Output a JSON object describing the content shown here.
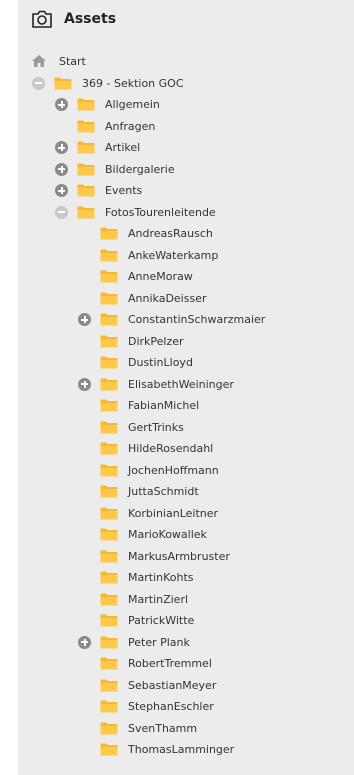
{
  "header": {
    "title": "Assets",
    "icon": "camera-icon"
  },
  "colors": {
    "panel_bg": "#ececec",
    "folder": "#f7b731",
    "toggle": "#8a8a8a"
  },
  "tree": {
    "items": [
      {
        "label": "Start",
        "level": 0,
        "icon": "home-icon",
        "toggle": "none"
      },
      {
        "label": "369 - Sektion GOC",
        "level": 1,
        "icon": "folder-icon",
        "toggle": "minus"
      },
      {
        "label": "Allgemein",
        "level": 2,
        "icon": "folder-icon",
        "toggle": "plus"
      },
      {
        "label": "Anfragen",
        "level": 2,
        "icon": "folder-icon",
        "toggle": "none"
      },
      {
        "label": "Artikel",
        "level": 2,
        "icon": "folder-icon",
        "toggle": "plus"
      },
      {
        "label": "Bildergalerie",
        "level": 2,
        "icon": "folder-icon",
        "toggle": "plus"
      },
      {
        "label": "Events",
        "level": 2,
        "icon": "folder-icon",
        "toggle": "plus"
      },
      {
        "label": "FotosTourenleitende",
        "level": 2,
        "icon": "folder-icon",
        "toggle": "minus"
      },
      {
        "label": "AndreasRausch",
        "level": 3,
        "icon": "folder-icon",
        "toggle": "none"
      },
      {
        "label": "AnkeWaterkamp",
        "level": 3,
        "icon": "folder-icon",
        "toggle": "none"
      },
      {
        "label": "AnneMoraw",
        "level": 3,
        "icon": "folder-icon",
        "toggle": "none"
      },
      {
        "label": "AnnikaDeisser",
        "level": 3,
        "icon": "folder-icon",
        "toggle": "none"
      },
      {
        "label": "ConstantinSchwarzmaier",
        "level": 3,
        "icon": "folder-icon",
        "toggle": "plus"
      },
      {
        "label": "DirkPelzer",
        "level": 3,
        "icon": "folder-icon",
        "toggle": "none"
      },
      {
        "label": "DustinLloyd",
        "level": 3,
        "icon": "folder-icon",
        "toggle": "none"
      },
      {
        "label": "ElisabethWeininger",
        "level": 3,
        "icon": "folder-icon",
        "toggle": "plus"
      },
      {
        "label": "FabianMichel",
        "level": 3,
        "icon": "folder-icon",
        "toggle": "none"
      },
      {
        "label": "GertTrinks",
        "level": 3,
        "icon": "folder-icon",
        "toggle": "none"
      },
      {
        "label": "HildeRosendahl",
        "level": 3,
        "icon": "folder-icon",
        "toggle": "none"
      },
      {
        "label": "JochenHoffmann",
        "level": 3,
        "icon": "folder-icon",
        "toggle": "none"
      },
      {
        "label": "JuttaSchmidt",
        "level": 3,
        "icon": "folder-icon",
        "toggle": "none"
      },
      {
        "label": "KorbinianLeitner",
        "level": 3,
        "icon": "folder-icon",
        "toggle": "none"
      },
      {
        "label": "MarioKowallek",
        "level": 3,
        "icon": "folder-icon",
        "toggle": "none"
      },
      {
        "label": "MarkusArmbruster",
        "level": 3,
        "icon": "folder-icon",
        "toggle": "none"
      },
      {
        "label": "MartinKohts",
        "level": 3,
        "icon": "folder-icon",
        "toggle": "none"
      },
      {
        "label": "MartinZierl",
        "level": 3,
        "icon": "folder-icon",
        "toggle": "none"
      },
      {
        "label": "PatrickWitte",
        "level": 3,
        "icon": "folder-icon",
        "toggle": "none"
      },
      {
        "label": "Peter Plank",
        "level": 3,
        "icon": "folder-icon",
        "toggle": "plus"
      },
      {
        "label": "RobertTremmel",
        "level": 3,
        "icon": "folder-icon",
        "toggle": "none"
      },
      {
        "label": "SebastianMeyer",
        "level": 3,
        "icon": "folder-icon",
        "toggle": "none"
      },
      {
        "label": "StephanEschler",
        "level": 3,
        "icon": "folder-icon",
        "toggle": "none"
      },
      {
        "label": "SvenThamm",
        "level": 3,
        "icon": "folder-icon",
        "toggle": "none"
      },
      {
        "label": "ThomasLamminger",
        "level": 3,
        "icon": "folder-icon",
        "toggle": "none"
      }
    ]
  }
}
